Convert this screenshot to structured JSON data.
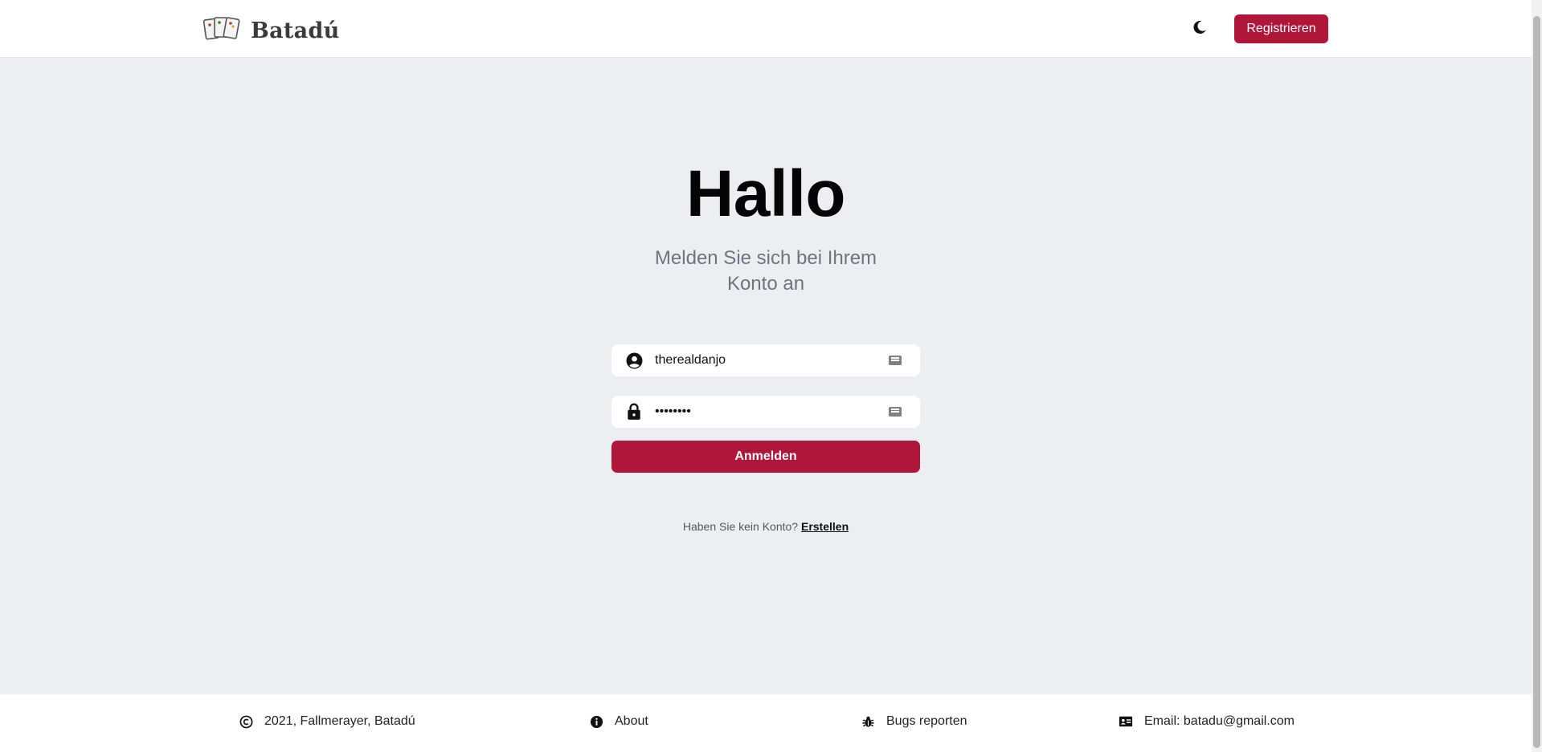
{
  "header": {
    "logo_text": "Batadú",
    "logo_icon": "playing-cards-icon",
    "theme_toggle_icon": "moon-icon",
    "register_label": "Registrieren"
  },
  "main": {
    "title": "Hallo",
    "subtitle": "Melden Sie sich bei Ihrem Konto an",
    "username": {
      "icon": "user-circle-icon",
      "value": "therealdanjo"
    },
    "password": {
      "icon": "lock-icon",
      "value": "••••••••"
    },
    "login_label": "Anmelden",
    "signup_prompt": "Haben Sie kein Konto?",
    "signup_link": "Erstellen"
  },
  "footer": {
    "copyright": {
      "icon": "copyright-icon",
      "text": "2021, Fallmerayer, Batadú"
    },
    "about": {
      "icon": "info-icon",
      "text": "About"
    },
    "bugs": {
      "icon": "bug-icon",
      "text": "Bugs reporten"
    },
    "email": {
      "icon": "contact-card-icon",
      "text": "Email: batadu@gmail.com"
    }
  },
  "colors": {
    "accent": "#b0153a",
    "background": "#edeef2",
    "surface": "#ffffff"
  }
}
